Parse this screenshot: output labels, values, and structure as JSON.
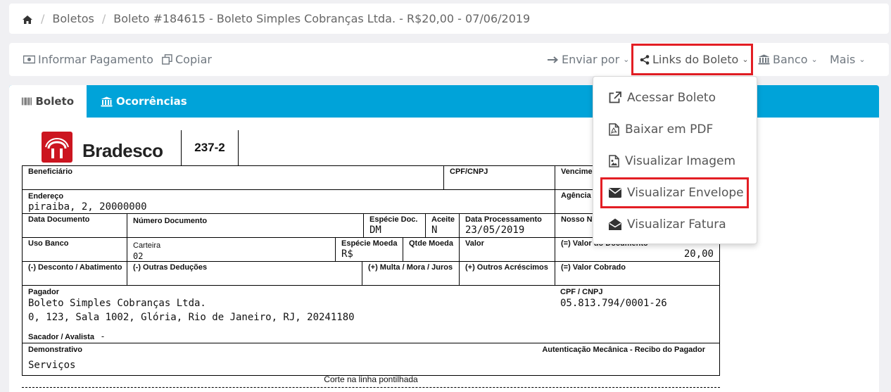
{
  "breadcrumb": {
    "items": [
      "Boletos",
      "Boleto #184615 - Boleto Simples Cobranças Ltda. - R$20,00 - 07/06/2019"
    ]
  },
  "toolbar": {
    "informar_pagamento": "Informar Pagamento",
    "copiar": "Copiar",
    "enviar_por": "Enviar por",
    "links_do_boleto": "Links do Boleto",
    "banco": "Banco",
    "mais": "Mais"
  },
  "tabs": [
    {
      "label": "Boleto"
    },
    {
      "label": "Ocorrências"
    }
  ],
  "dropdown": {
    "items": [
      {
        "label": "Acessar Boleto",
        "icon": "external-link-icon"
      },
      {
        "label": "Baixar em PDF",
        "icon": "pdf-file-icon"
      },
      {
        "label": "Visualizar Imagem",
        "icon": "image-file-icon"
      },
      {
        "label": "Visualizar Envelope",
        "icon": "envelope-icon"
      },
      {
        "label": "Visualizar Fatura",
        "icon": "envelope-open-icon"
      }
    ]
  },
  "boleto": {
    "bank_name": "Bradesco",
    "bank_code": "237-2",
    "beneficiario_label": "Beneficiário",
    "cpf_cnpj_label": "CPF/CNPJ",
    "vencimento_label": "Vencime",
    "endereco_label": "Endereço",
    "endereco_value": "piraiba, 2, 20000000",
    "agencia_label": "Agência",
    "data_documento_label": "Data Documento",
    "numero_documento_label": "Número Documento",
    "especie_doc_label": "Espécie Doc.",
    "especie_doc_value": "DM",
    "aceite_label": "Aceite",
    "aceite_value": "N",
    "data_processamento_label": "Data Processamento",
    "data_processamento_value": "23/05/2019",
    "nosso_numero_label": "Nosso N",
    "uso_banco_label": "Uso Banco",
    "carteira_label": "Carteira",
    "carteira_value": "02",
    "especie_moeda_label": "Espécie Moeda",
    "especie_moeda_value": "R$",
    "qtde_moeda_label": "Qtde Moeda",
    "valor_label": "Valor",
    "valor_documento_label": "(=) Valor do Documento",
    "valor_documento_value": "20,00",
    "desconto_label": "(-) Desconto / Abatimento",
    "outras_deducoes_label": "(-) Outras Deduções",
    "multa_label": "(+) Multa / Mora / Juros",
    "outros_acrescimos_label": "(+) Outros Acréscimos",
    "valor_cobrado_label": "(=) Valor Cobrado",
    "pagador_label": "Pagador",
    "pagador_name": "Boleto Simples Cobranças Ltda.",
    "pagador_address": "0, 123, Sala 1002, Glória, Rio de Janeiro, RJ, 20241180",
    "pagador_cpf_label": "CPF / CNPJ",
    "pagador_cpf_value": "05.813.794/0001-26",
    "sacador_label": "Sacador / Avalista",
    "sacador_value": "-",
    "demonstrativo_label": "Demonstrativo",
    "demonstrativo_value": "Serviços",
    "autenticacao_label": "Autenticação Mecânica - Recibo do Pagador",
    "corte_label": "Corte na linha pontilhada"
  },
  "colors": {
    "tab_bar": "#00a3d9",
    "highlight": "#e31e24",
    "bank_red": "#cc1520"
  }
}
